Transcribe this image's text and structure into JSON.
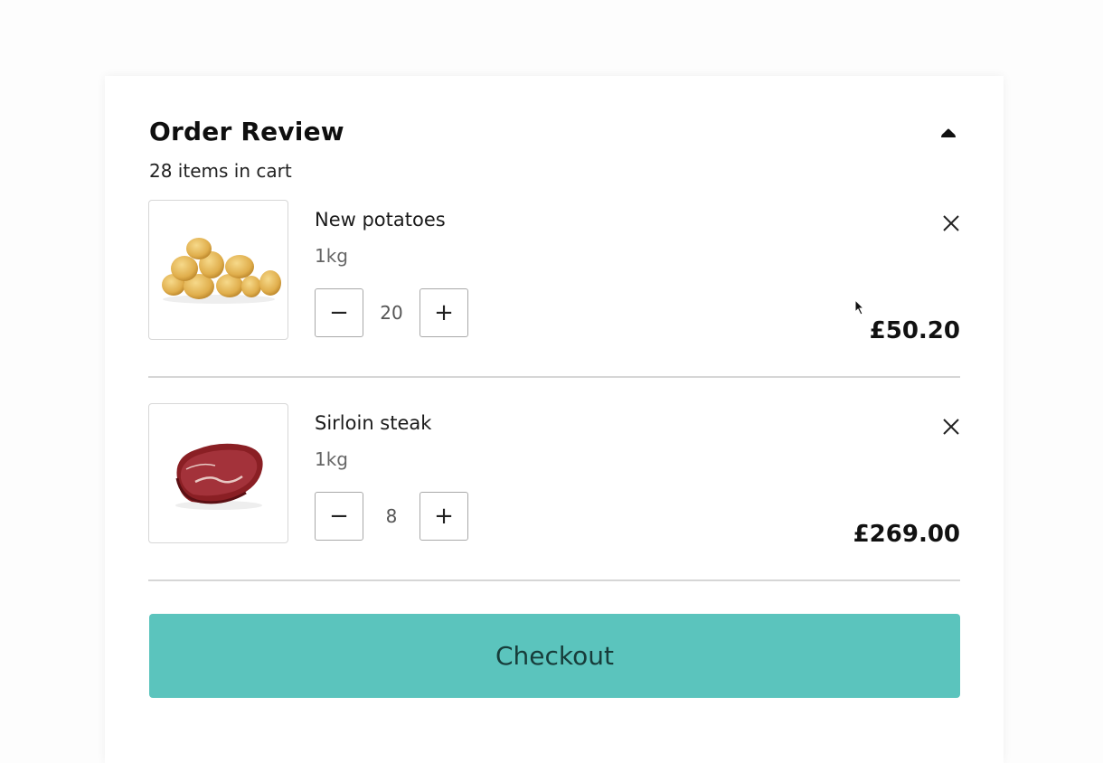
{
  "header": {
    "title": "Order Review",
    "subtitle": "28 items in cart",
    "collapse_icon": "caret-up-icon"
  },
  "items": [
    {
      "name": "New potatoes",
      "size": "1kg",
      "quantity": "20",
      "price": "£50.20",
      "image": "potatoes-image"
    },
    {
      "name": "Sirloin steak",
      "size": "1kg",
      "quantity": "8",
      "price": "£269.00",
      "image": "steak-image"
    }
  ],
  "stepper": {
    "decrement_symbol": "−",
    "increment_symbol": "+"
  },
  "checkout": {
    "label": "Checkout"
  },
  "colors": {
    "checkout_bg": "#5bc4bd",
    "checkout_text": "#173c3a"
  }
}
